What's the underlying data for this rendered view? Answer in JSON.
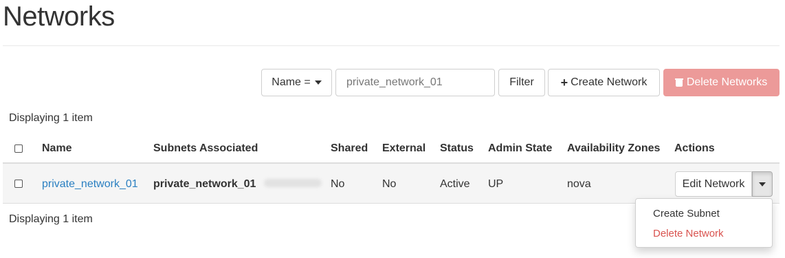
{
  "page": {
    "title": "Networks"
  },
  "toolbar": {
    "filter_field": "Name =",
    "search": {
      "value": "",
      "placeholder": "private_network_01"
    },
    "filter_label": "Filter",
    "create_label": "Create Network",
    "delete_label": "Delete Networks"
  },
  "table": {
    "count_label": "Displaying 1 item",
    "headers": {
      "name": "Name",
      "subnets": "Subnets Associated",
      "shared": "Shared",
      "external": "External",
      "status": "Status",
      "admin_state": "Admin State",
      "zones": "Availability Zones",
      "actions": "Actions"
    },
    "rows": [
      {
        "name": "private_network_01",
        "subnets": "private_network_01",
        "shared": "No",
        "external": "No",
        "status": "Active",
        "admin_state": "UP",
        "zones": "nova",
        "action": "Edit Network"
      }
    ]
  },
  "dropdown": {
    "items": [
      "Create Subnet",
      "Delete Network"
    ]
  },
  "colors": {
    "link": "#2a7fc1",
    "danger": "#d9534f",
    "delete_button_bg": "#ec9a99"
  },
  "icons": {
    "filter_caret": "chevron-down-icon",
    "create": "plus-icon",
    "delete": "trash-icon",
    "row_toggle": "chevron-down-icon"
  }
}
